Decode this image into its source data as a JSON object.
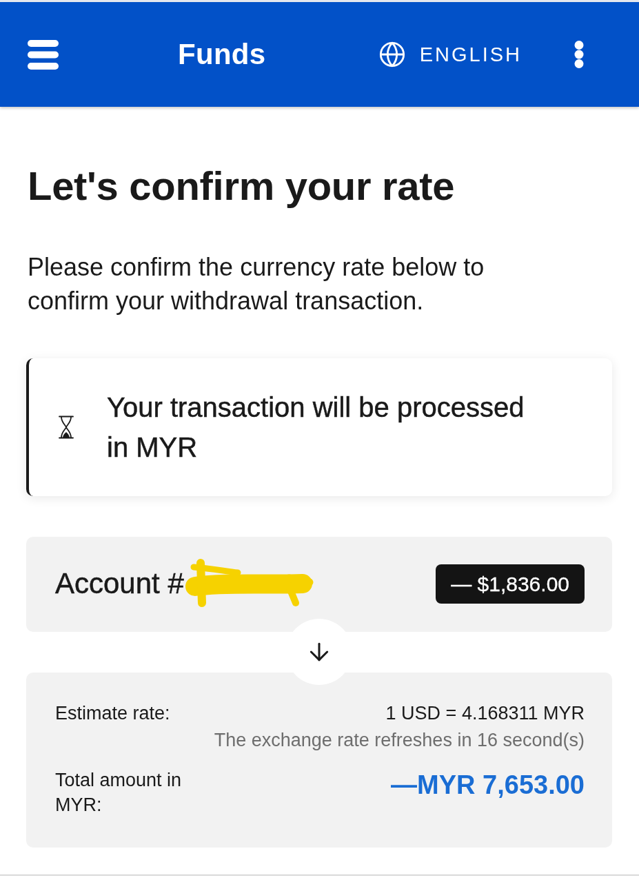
{
  "app_bar": {
    "title": "Funds",
    "language": "ENGLISH"
  },
  "heading": "Let's confirm your rate",
  "description": "Please confirm the currency rate below to confirm your withdrawal transaction.",
  "notice": {
    "text": "Your transaction will be processed in MYR"
  },
  "account": {
    "label": "Account #",
    "redacted": true,
    "amount": "— $1,836.00"
  },
  "summary": {
    "rows": [
      {
        "kind": "rate",
        "label": "Estimate rate:",
        "value": "1 USD = 4.168311 MYR",
        "note": "The exchange rate refreshes in 16 second(s)"
      },
      {
        "kind": "total",
        "label": "Total amount in MYR:",
        "value": "—MYR 7,653.00"
      }
    ]
  }
}
